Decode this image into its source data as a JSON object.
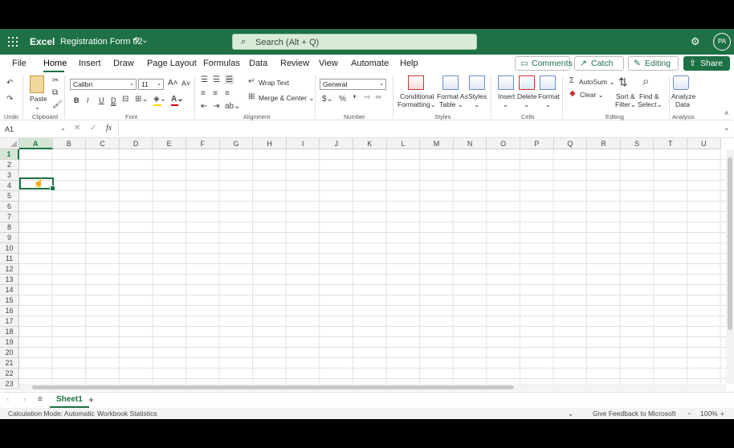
{
  "titlebar": {
    "app_name": "Excel",
    "doc_title": "Registration Form 02",
    "search_placeholder": "Search (Alt + Q)",
    "avatar_initials": "PA"
  },
  "menu": {
    "tabs": [
      "File",
      "Home",
      "Insert",
      "Draw",
      "Page Layout",
      "Formulas",
      "Data",
      "Review",
      "View",
      "Automate",
      "Help"
    ],
    "active_tab": "Home",
    "comments_label": "Comments",
    "catchup_label": "Catch up",
    "editing_label": "Editing",
    "share_label": "Share"
  },
  "ribbon": {
    "undo_label": "Undo",
    "clipboard": {
      "paste_label": "Paste",
      "group_label": "Clipboard"
    },
    "font": {
      "name": "Calibri",
      "size": "11",
      "group_label": "Font",
      "bold": "B",
      "italic": "I",
      "underline": "U",
      "double_underline": "D"
    },
    "alignment": {
      "wrap_label": "Wrap Text",
      "merge_label": "Merge & Center",
      "group_label": "Alignment"
    },
    "number": {
      "format": "General",
      "group_label": "Number"
    },
    "styles": {
      "conditional_label_1": "Conditional",
      "conditional_label_2": "Formatting",
      "format_table_1": "Format As",
      "format_table_2": "Table",
      "styles_label": "Styles",
      "group_label": "Styles"
    },
    "cells": {
      "insert_label": "Insert",
      "delete_label": "Delete",
      "format_label": "Format",
      "group_label": "Cells"
    },
    "editing": {
      "autosum_label": "AutoSum",
      "clear_label": "Clear",
      "sort_1": "Sort &",
      "sort_2": "Filter",
      "find_1": "Find &",
      "find_2": "Select",
      "group_label": "Editing"
    },
    "analysis": {
      "analyze_1": "Analyze",
      "analyze_2": "Data",
      "group_label": "Analysis"
    }
  },
  "formula_bar": {
    "name_box": "A1",
    "fx": "fx",
    "value": ""
  },
  "grid": {
    "columns": [
      "A",
      "B",
      "C",
      "D",
      "E",
      "F",
      "G",
      "H",
      "I",
      "J",
      "K",
      "L",
      "M",
      "N",
      "O",
      "P",
      "Q",
      "R",
      "S",
      "T",
      "U"
    ],
    "rows": [
      "1",
      "2",
      "3",
      "4",
      "5",
      "6",
      "7",
      "8",
      "9",
      "10",
      "11",
      "12",
      "13",
      "14",
      "15",
      "16",
      "17",
      "18",
      "19",
      "20",
      "21",
      "22",
      "23"
    ],
    "active_cell": "A1"
  },
  "sheets": {
    "tabs": [
      "Sheet1"
    ],
    "active": "Sheet1"
  },
  "status": {
    "calc_mode": "Calculation Mode: Automatic",
    "workbook_stats": "Workbook Statistics",
    "feedback": "Give Feedback to Microsoft",
    "zoom": "100%"
  },
  "colors": {
    "brand": "#1e7145"
  }
}
